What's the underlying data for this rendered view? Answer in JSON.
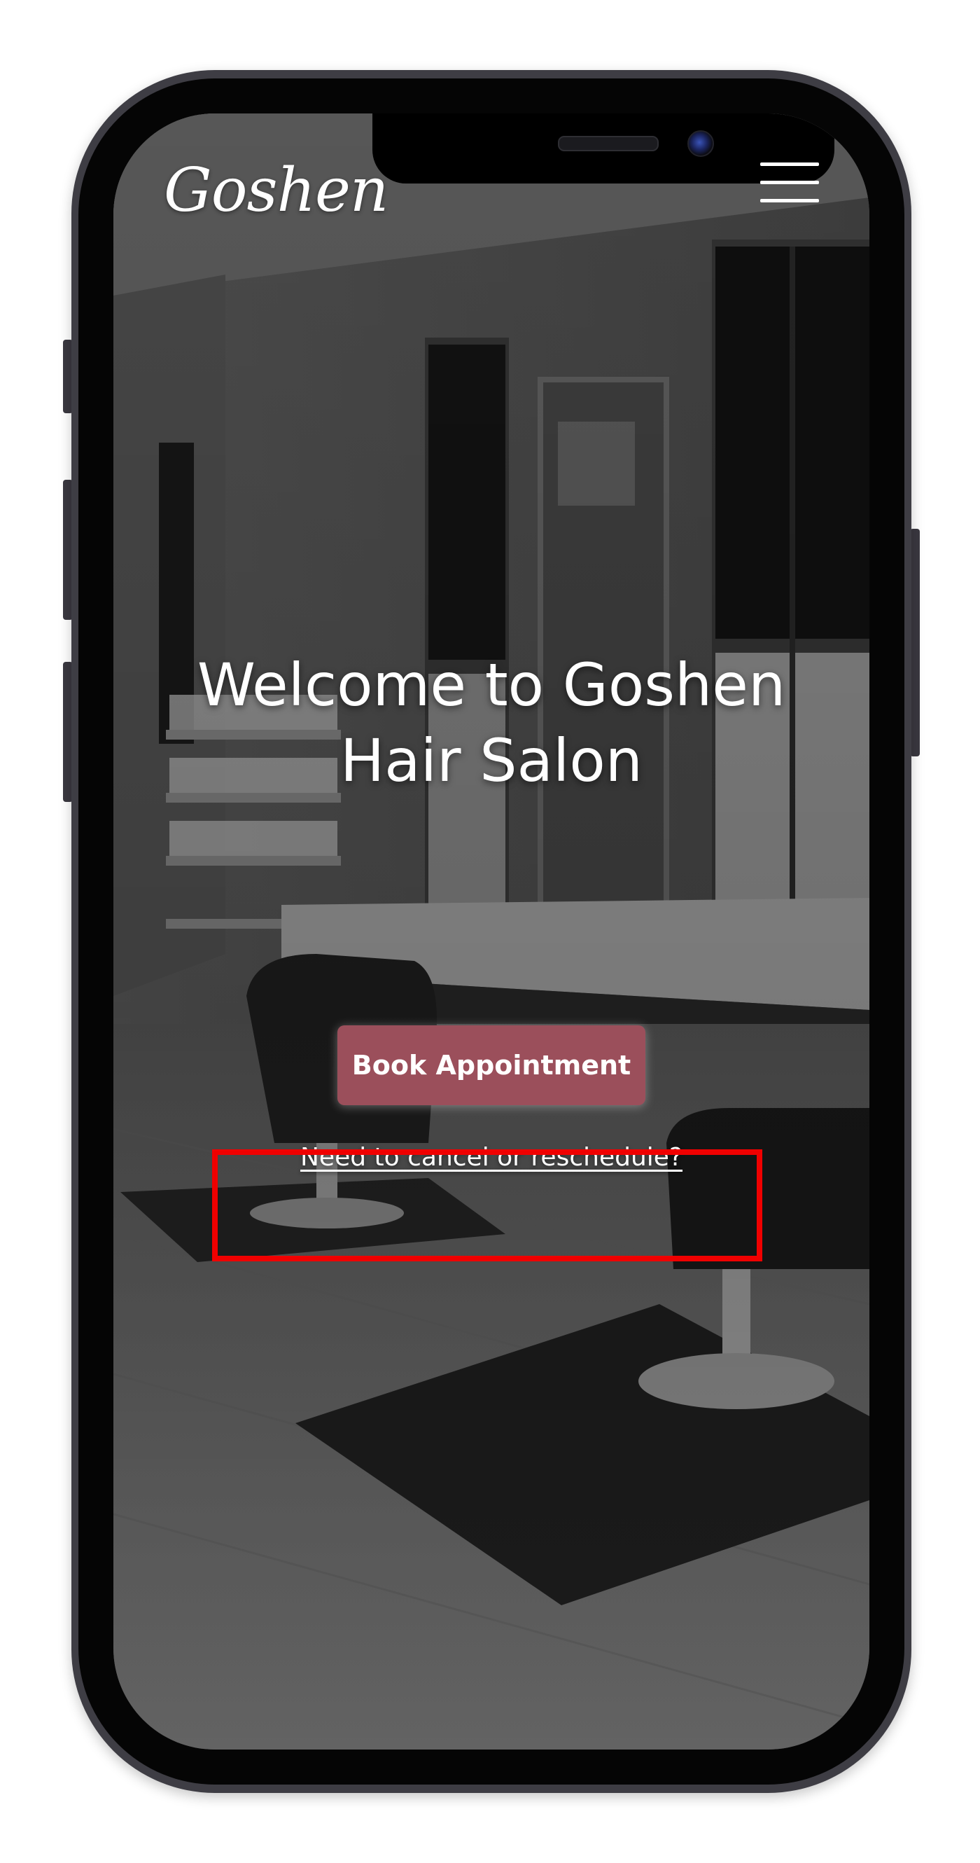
{
  "site": {
    "logo_text": "Goshen"
  },
  "header": {
    "menu_icon": "hamburger-menu-icon"
  },
  "hero": {
    "title_line1": "Welcome to Goshen",
    "title_line2": "Hair Salon",
    "book_button_label": "Book Appointment",
    "reschedule_link_label": "Need to cancel or reschedule?"
  },
  "colors": {
    "book_button": "#9b4f5b",
    "highlight_box": "#f00000",
    "text": "#ffffff"
  }
}
